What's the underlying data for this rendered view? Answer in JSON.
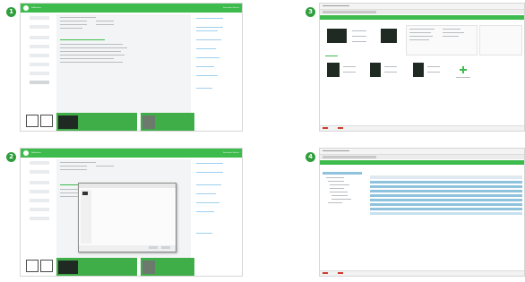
{
  "steps": [
    "1",
    "2",
    "3",
    "4"
  ],
  "app": {
    "title": "SoMachine",
    "brand": "Schneider Electric",
    "accent": "#3dbb4c"
  },
  "icons": {
    "logo": "se-logo-icon",
    "add": "plus-icon",
    "device": "controller-device-icon"
  }
}
